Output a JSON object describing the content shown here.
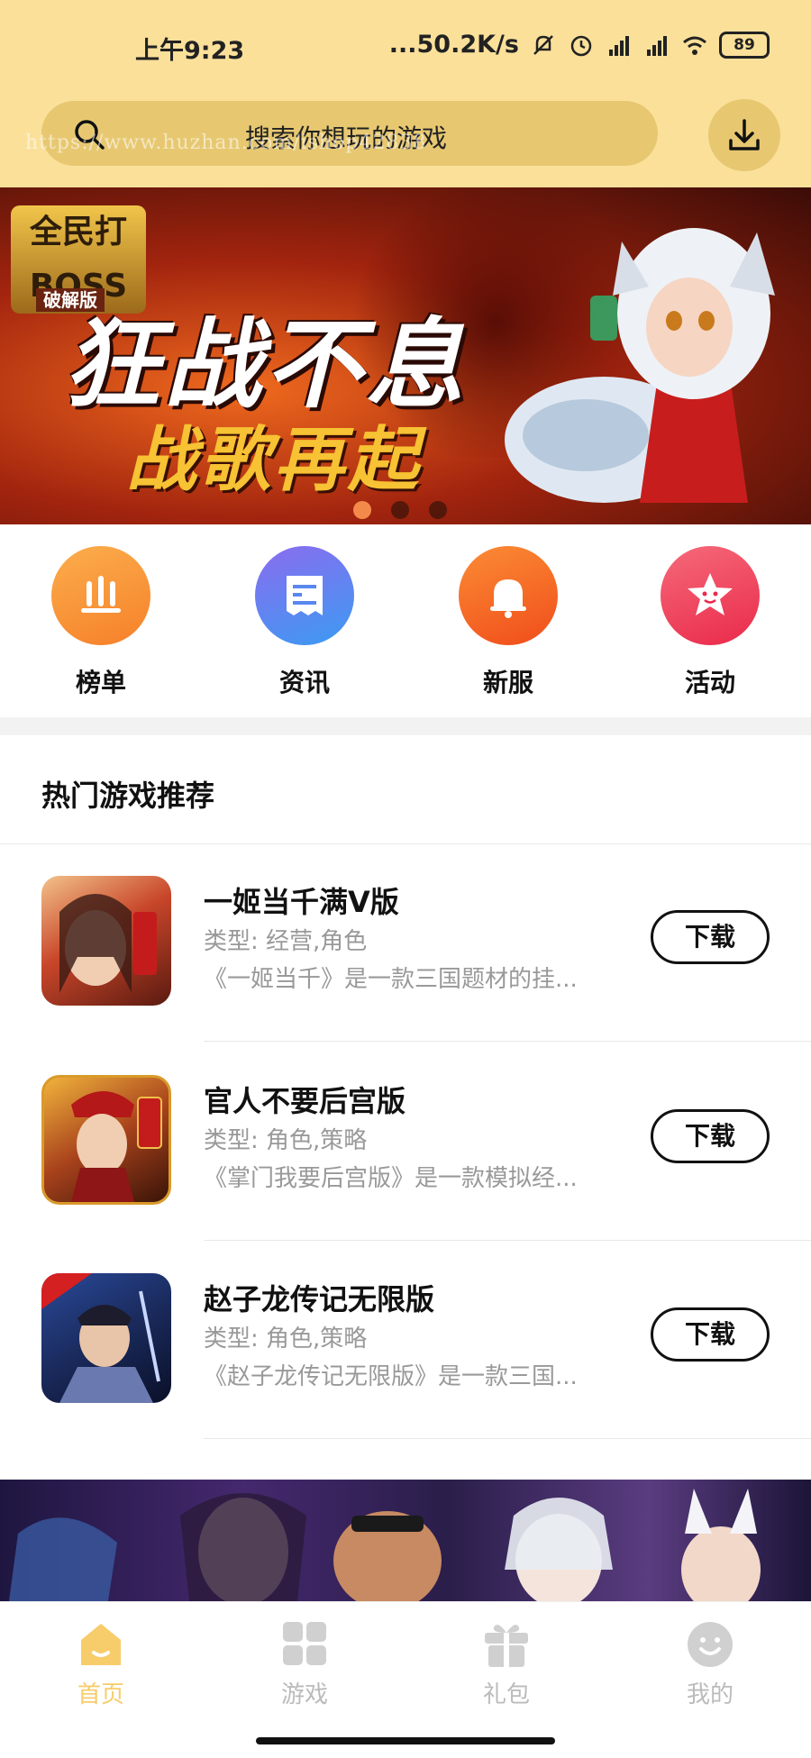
{
  "status_bar": {
    "time": "上午9:23",
    "network_speed": "...50.2K/s",
    "battery": "89",
    "icons": [
      "mute-icon",
      "alarm-icon",
      "signal-hd-icon",
      "signal-hd-icon",
      "wifi-icon",
      "battery-icon"
    ]
  },
  "search": {
    "placeholder": "搜索你想玩的游戏",
    "watermark": "https://www.huzhan.com/ishop42838",
    "icon": "search-icon"
  },
  "download_icon": "download-icon",
  "banner": {
    "logo_title": "全民打BOSS",
    "logo_sub": "破解版",
    "headline1": "狂战不息",
    "headline2": "战歌再起",
    "slide_count": 3,
    "active_slide": 1
  },
  "quick_menu": [
    {
      "label": "榜单",
      "icon": "chart-icon",
      "color": "#f8932f"
    },
    {
      "label": "资讯",
      "icon": "news-icon",
      "color": "#4a86f0"
    },
    {
      "label": "新服",
      "icon": "bell-icon",
      "color": "#f56a22"
    },
    {
      "label": "活动",
      "icon": "star-icon",
      "color": "#f2405b"
    }
  ],
  "section": {
    "title": "热门游戏推荐"
  },
  "games": [
    {
      "name": "一姬当千满V版",
      "type": "类型: 经营,角色",
      "desc": "《一姬当千》是一款三国题材的挂...",
      "button": "下载"
    },
    {
      "name": "官人不要后宫版",
      "type": "类型: 角色,策略",
      "desc": "《掌门我要后宫版》是一款模拟经...",
      "button": "下载"
    },
    {
      "name": "赵子龙传记无限版",
      "type": "类型: 角色,策略",
      "desc": "《赵子龙传记无限版》是一款三国...",
      "button": "下载"
    }
  ],
  "nav": [
    {
      "label": "首页",
      "icon": "home-icon",
      "active": true
    },
    {
      "label": "游戏",
      "icon": "grid-icon",
      "active": false
    },
    {
      "label": "礼包",
      "icon": "gift-icon",
      "active": false
    },
    {
      "label": "我的",
      "icon": "profile-icon",
      "active": false
    }
  ],
  "colors": {
    "accent": "#fbe09a",
    "nav_active": "#f7cc6a",
    "nav_inactive": "#cccccc"
  }
}
